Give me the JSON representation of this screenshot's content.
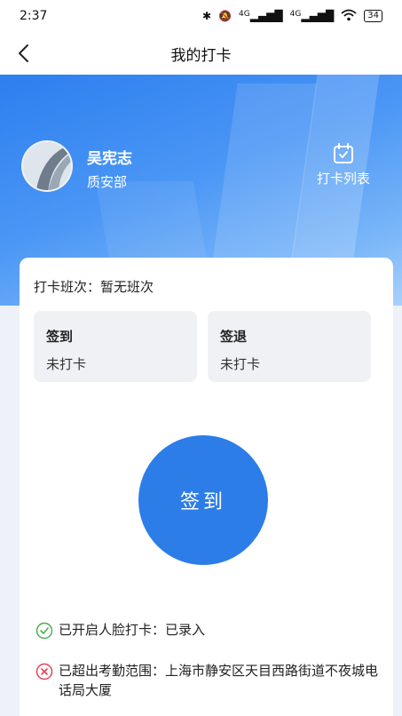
{
  "status_bar": {
    "time": "2:37",
    "battery": "34",
    "network": "4G"
  },
  "nav": {
    "title": "我的打卡"
  },
  "user": {
    "name": "吴宪志",
    "department": "质安部"
  },
  "list_link": {
    "label": "打卡列表"
  },
  "shift": {
    "label": "打卡班次：",
    "value": "暂无班次"
  },
  "tiles": [
    {
      "title": "签到",
      "status": "未打卡"
    },
    {
      "title": "签退",
      "status": "未打卡"
    }
  ],
  "checkin_button": {
    "label": "签到"
  },
  "notes": {
    "face": {
      "text": "已开启人脸打卡：已录入"
    },
    "range": {
      "text": "已超出考勤范围：上海市静安区天目西路街道不夜城电话局大厦"
    }
  },
  "colors": {
    "primary": "#2c7de8",
    "success": "#4caf50",
    "error": "#e0435a"
  }
}
